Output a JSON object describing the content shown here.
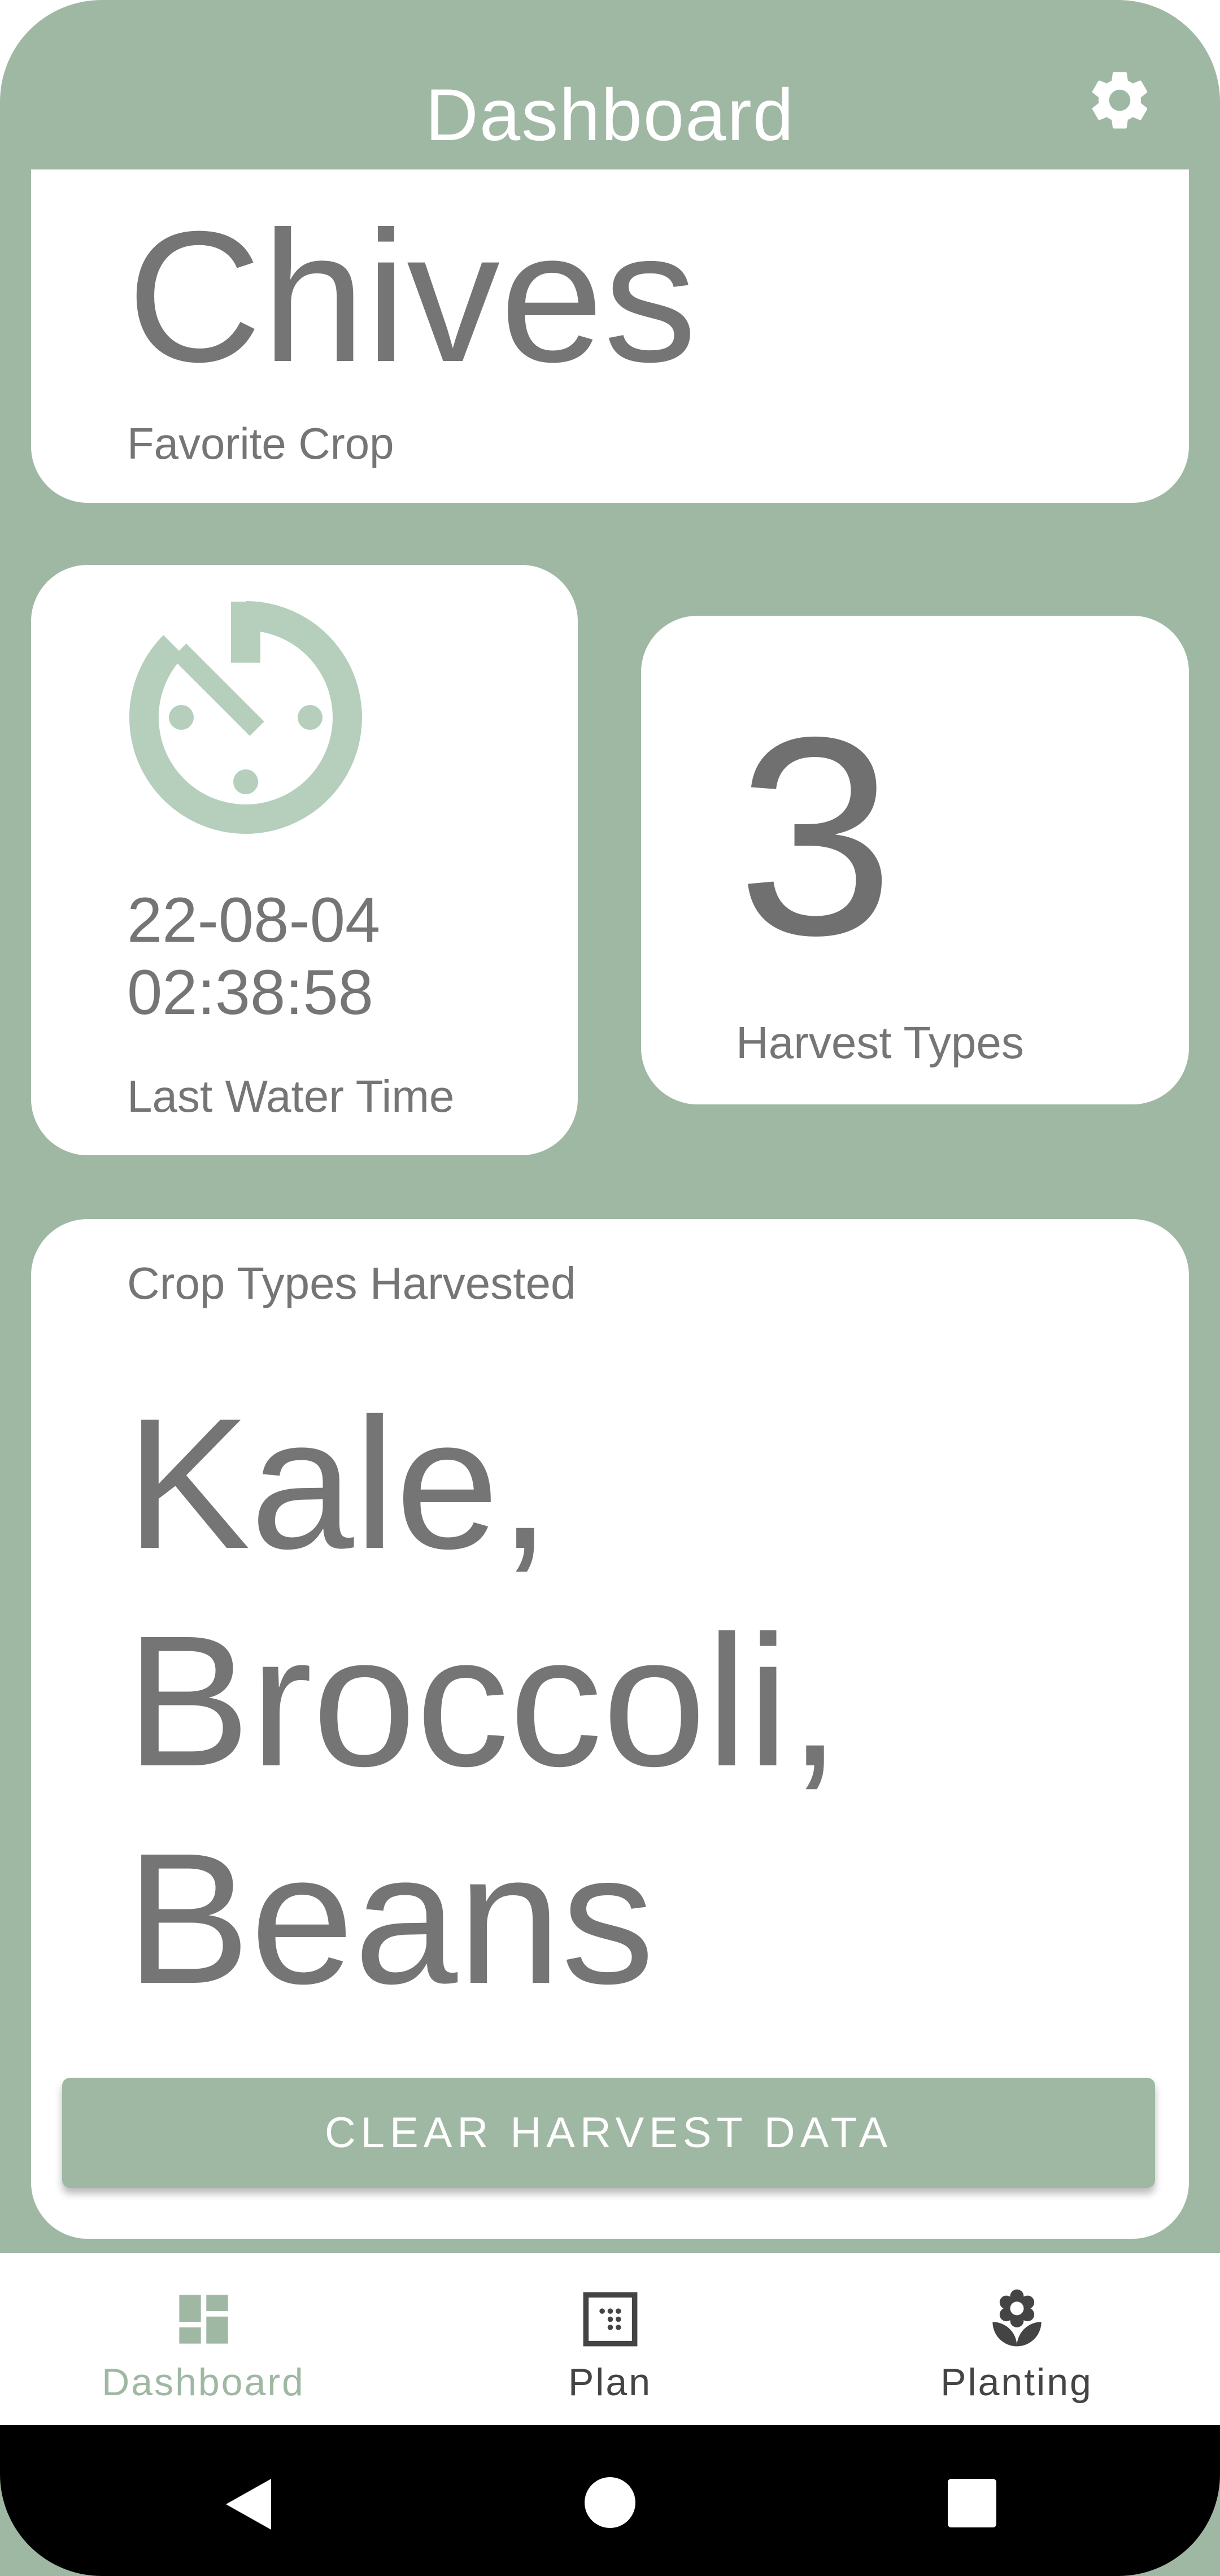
{
  "appbar": {
    "title": "Dashboard"
  },
  "favorite_crop": {
    "name": "Chives",
    "label": "Favorite Crop"
  },
  "last_water": {
    "date": "22-08-04",
    "time": "02:38:58",
    "label": "Last Water Time"
  },
  "harvest_types": {
    "count": "3",
    "label": "Harvest Types"
  },
  "crop_types": {
    "label": "Crop Types Harvested",
    "items": [
      "Kale,",
      "Broccoli,",
      "Beans"
    ],
    "clear_button": "CLEAR HARVEST DATA"
  },
  "bottom_nav": {
    "items": [
      {
        "label": "Dashboard",
        "icon": "dashboard-icon",
        "active": true
      },
      {
        "label": "Plan",
        "icon": "grid-icon",
        "active": false
      },
      {
        "label": "Planting",
        "icon": "flower-icon",
        "active": false
      }
    ]
  },
  "system_nav": {
    "buttons": [
      "back-icon",
      "home-icon",
      "recents-icon"
    ]
  },
  "colors": {
    "primary": "#9fb8a3",
    "clock_icon": "#b6cfbc",
    "card": "#ffffff",
    "text": "#757575",
    "nav_active": "#9fb8a3",
    "nav_inactive": "#444444"
  }
}
